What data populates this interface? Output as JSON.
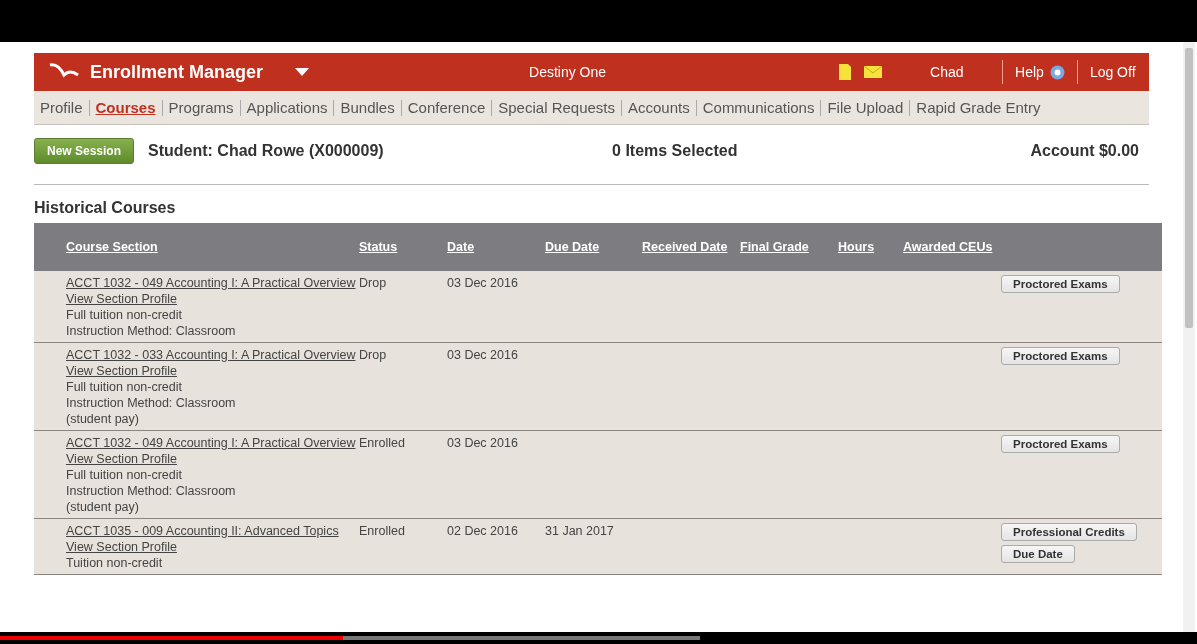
{
  "header": {
    "title": "Enrollment Manager",
    "institution": "Destiny One",
    "user": "Chad",
    "help": "Help",
    "logoff": "Log Off"
  },
  "nav": [
    {
      "label": "Profile",
      "selected": false
    },
    {
      "label": "Courses",
      "selected": true
    },
    {
      "label": "Programs",
      "selected": false
    },
    {
      "label": "Applications",
      "selected": false
    },
    {
      "label": "Bundles",
      "selected": false
    },
    {
      "label": "Conference",
      "selected": false
    },
    {
      "label": "Special Requests",
      "selected": false
    },
    {
      "label": "Accounts",
      "selected": false
    },
    {
      "label": "Communications",
      "selected": false
    },
    {
      "label": "File Upload",
      "selected": false
    },
    {
      "label": "Rapid Grade Entry",
      "selected": false
    }
  ],
  "session": {
    "button": "New Session",
    "student": "Student: Chad Rowe (X000009)",
    "selected": "0 Items Selected",
    "account": "Account $0.00"
  },
  "section_title": "Historical Courses",
  "table": {
    "columns": [
      "Course Section",
      "Status",
      "Date",
      "Due Date",
      "Received Date",
      "Final Grade",
      "Hours",
      "Awarded CEUs"
    ],
    "rows": [
      {
        "course": [
          {
            "kind": "link",
            "text": "ACCT 1032 - 049 Accounting I: A Practical Overview"
          },
          {
            "kind": "link",
            "text": "View Section Profile"
          },
          {
            "kind": "text",
            "text": "Full tuition non-credit"
          },
          {
            "kind": "text",
            "text": "Instruction Method: Classroom"
          }
        ],
        "status": "Drop",
        "date": "03 Dec 2016",
        "due_date": "",
        "buttons": [
          "Proctored Exams"
        ]
      },
      {
        "course": [
          {
            "kind": "link",
            "text": "ACCT 1032 - 033 Accounting I: A Practical Overview"
          },
          {
            "kind": "link",
            "text": "View Section Profile"
          },
          {
            "kind": "text",
            "text": "Full tuition non-credit"
          },
          {
            "kind": "text",
            "text": "Instruction Method: Classroom"
          },
          {
            "kind": "text",
            "text": "(student pay)"
          }
        ],
        "status": "Drop",
        "date": "03 Dec 2016",
        "due_date": "",
        "buttons": [
          "Proctored Exams"
        ]
      },
      {
        "course": [
          {
            "kind": "link",
            "text": "ACCT 1032 - 049 Accounting I: A Practical Overview"
          },
          {
            "kind": "link",
            "text": "View Section Profile"
          },
          {
            "kind": "text",
            "text": "Full tuition non-credit"
          },
          {
            "kind": "text",
            "text": "Instruction Method: Classroom"
          },
          {
            "kind": "text",
            "text": "(student pay)"
          }
        ],
        "status": "Enrolled",
        "date": "03 Dec 2016",
        "due_date": "",
        "buttons": [
          "Proctored Exams"
        ]
      },
      {
        "course": [
          {
            "kind": "link",
            "text": "ACCT 1035 - 009 Accounting II: Advanced Topics"
          },
          {
            "kind": "link",
            "text": "View Section Profile"
          },
          {
            "kind": "text",
            "text": "Tuition non-credit"
          }
        ],
        "status": "Enrolled",
        "date": "02 Dec 2016",
        "due_date": "31 Jan 2017",
        "buttons": [
          "Professional Credits",
          "Due Date"
        ]
      }
    ]
  },
  "video_player": {
    "level": 0.49
  }
}
